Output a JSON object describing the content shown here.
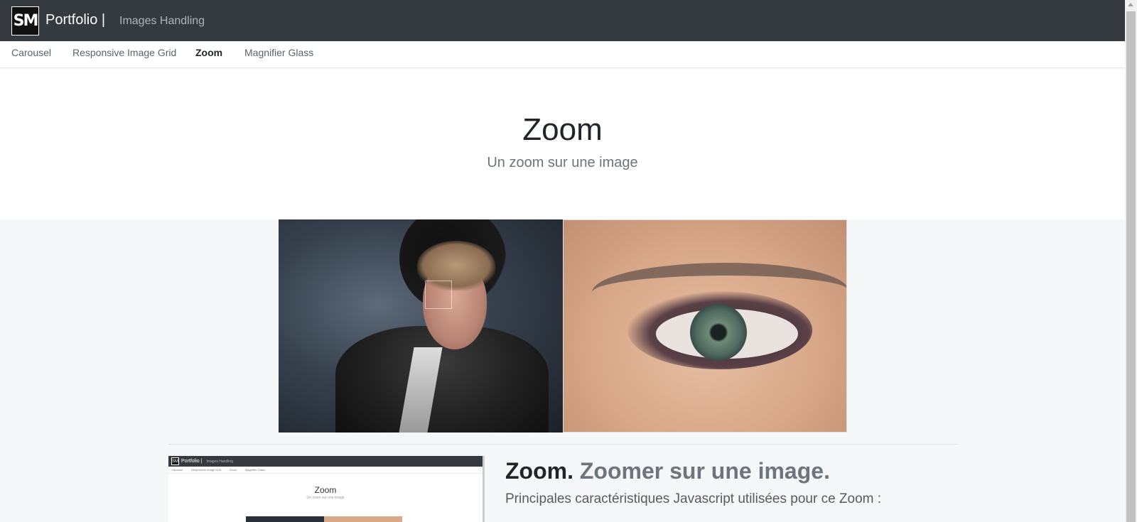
{
  "header": {
    "logo_text": "SM",
    "brand": "Portfolio |",
    "brand_sub": "Images Handling"
  },
  "nav": {
    "items": [
      {
        "label": "Carousel"
      },
      {
        "label": "Responsive Image Grid"
      },
      {
        "label": "Zoom"
      },
      {
        "label": "Magnifier Glass"
      }
    ],
    "active": "Zoom"
  },
  "hero": {
    "title": "Zoom",
    "subtitle": "Un zoom sur une image"
  },
  "feature": {
    "title_strong": "Zoom.",
    "title_muted": "Zoomer sur une image.",
    "description": "Principales caractéristiques Javascript utilisées pour ce Zoom :"
  },
  "thumbnail": {
    "logo_text": "SM",
    "brand": "Portfolio |",
    "brand_sub": "Images Handling",
    "nav": [
      "Carousel",
      "Responsive Image Grid",
      "Zoom",
      "Magnifier Glass"
    ],
    "title": "Zoom",
    "subtitle": "Un zoom sur une image"
  },
  "colors": {
    "navbar_bg": "#343a40",
    "section_bg": "#f6f7f9",
    "text_muted": "#6c757d"
  }
}
